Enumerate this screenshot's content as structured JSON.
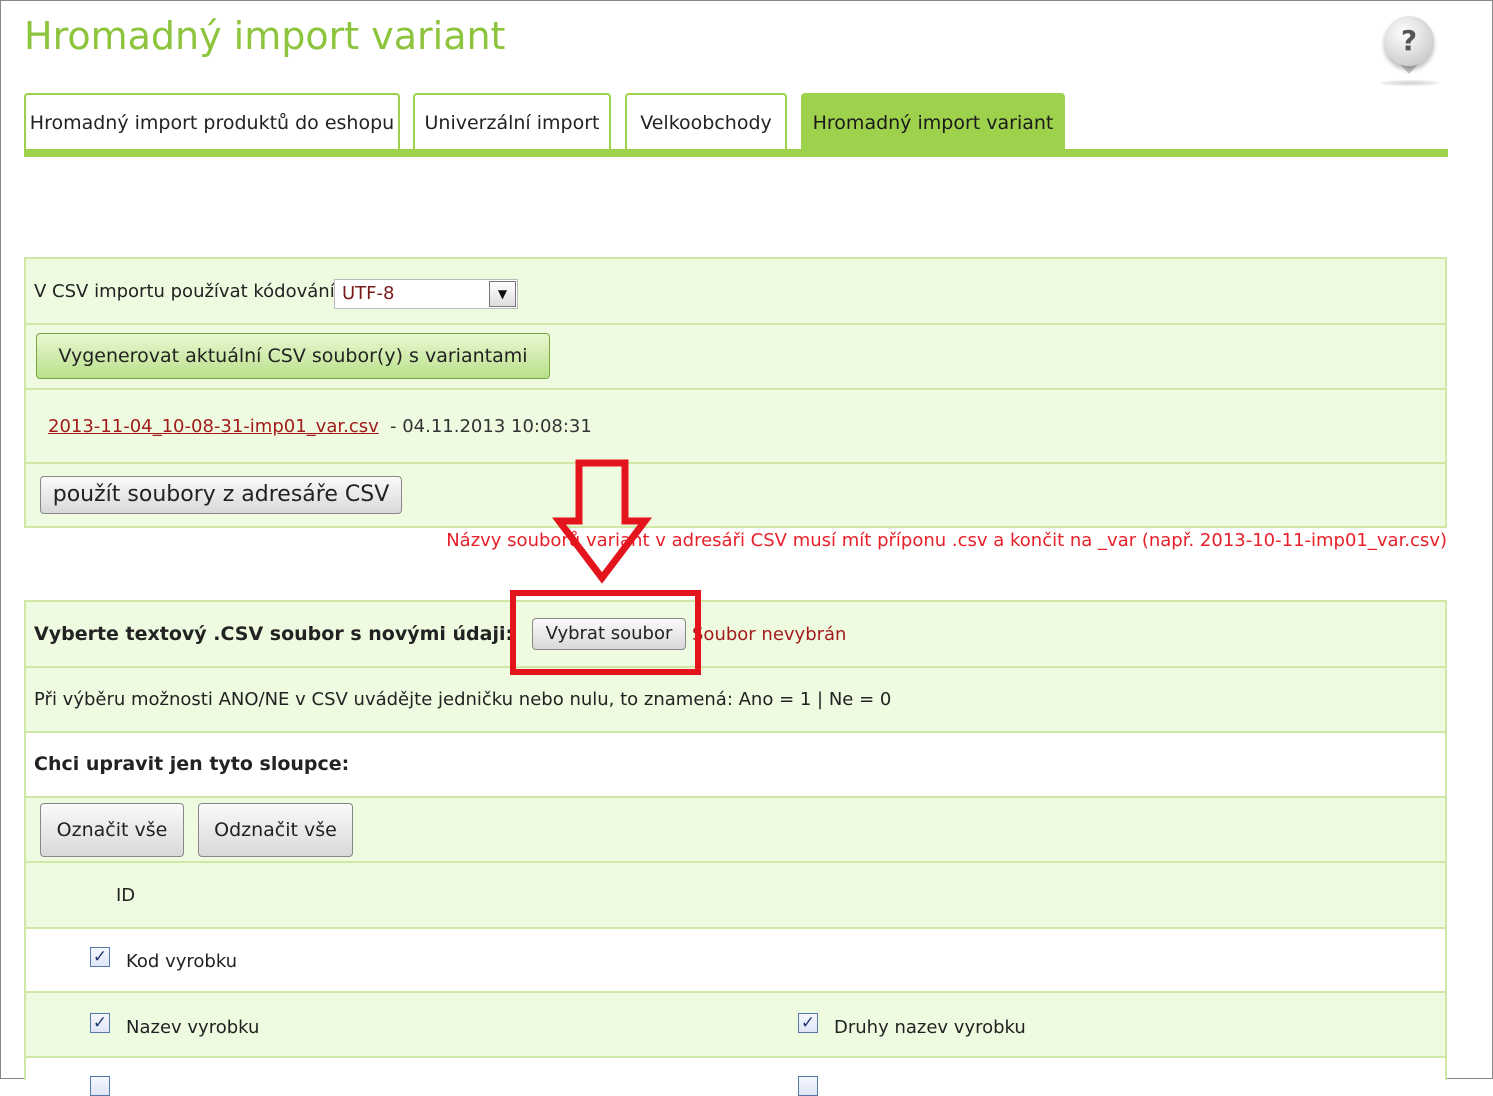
{
  "page": {
    "title": "Hromadný import variant",
    "help_symbol": "?"
  },
  "tabs": [
    {
      "label": "Hromadný import produktů do eshopu",
      "active": false
    },
    {
      "label": "Univerzální import",
      "active": false
    },
    {
      "label": "Velkoobchody",
      "active": false
    },
    {
      "label": "Hromadný import variant",
      "active": true
    }
  ],
  "csv_export": {
    "encoding_label": "V CSV importu používat kódování",
    "encoding_value": "UTF-8",
    "generate_button": "Vygenerovat aktuální CSV soubor(y) s variantami",
    "file_link": "2013-11-04_10-08-31-imp01_var.csv",
    "file_date": " - 04.11.2013 10:08:31",
    "use_dir_button": "použít soubory z adresáře CSV",
    "note": "Názvy souborů variant v adresáři CSV musí mít příponu .csv a končit na _var (např. 2013-10-11-imp01_var.csv)"
  },
  "import": {
    "file_label": "Vyberte textový .CSV soubor s novými údaji:",
    "choose_button": "Vybrat soubor",
    "no_file": "Soubor nevybrán",
    "hint": "Při výběru možnosti ANO/NE v CSV uvádějte jedničku nebo nulu, to znamená: Ano = 1 | Ne = 0",
    "columns_heading": "Chci upravit jen tyto sloupce:",
    "select_all": "Označit vše",
    "deselect_all": "Odznačit vše",
    "columns": [
      {
        "label": "ID"
      },
      {
        "label": "Kod vyrobku",
        "checked": true
      },
      {
        "label": "Nazev vyrobku",
        "checked": true
      },
      {
        "label": "Druhy nazev vyrobku",
        "checked": true
      }
    ]
  },
  "colors": {
    "accent": "#9ed24c",
    "title": "#8cc43c",
    "warning": "#e8202a",
    "annotation": "#e3141b"
  }
}
